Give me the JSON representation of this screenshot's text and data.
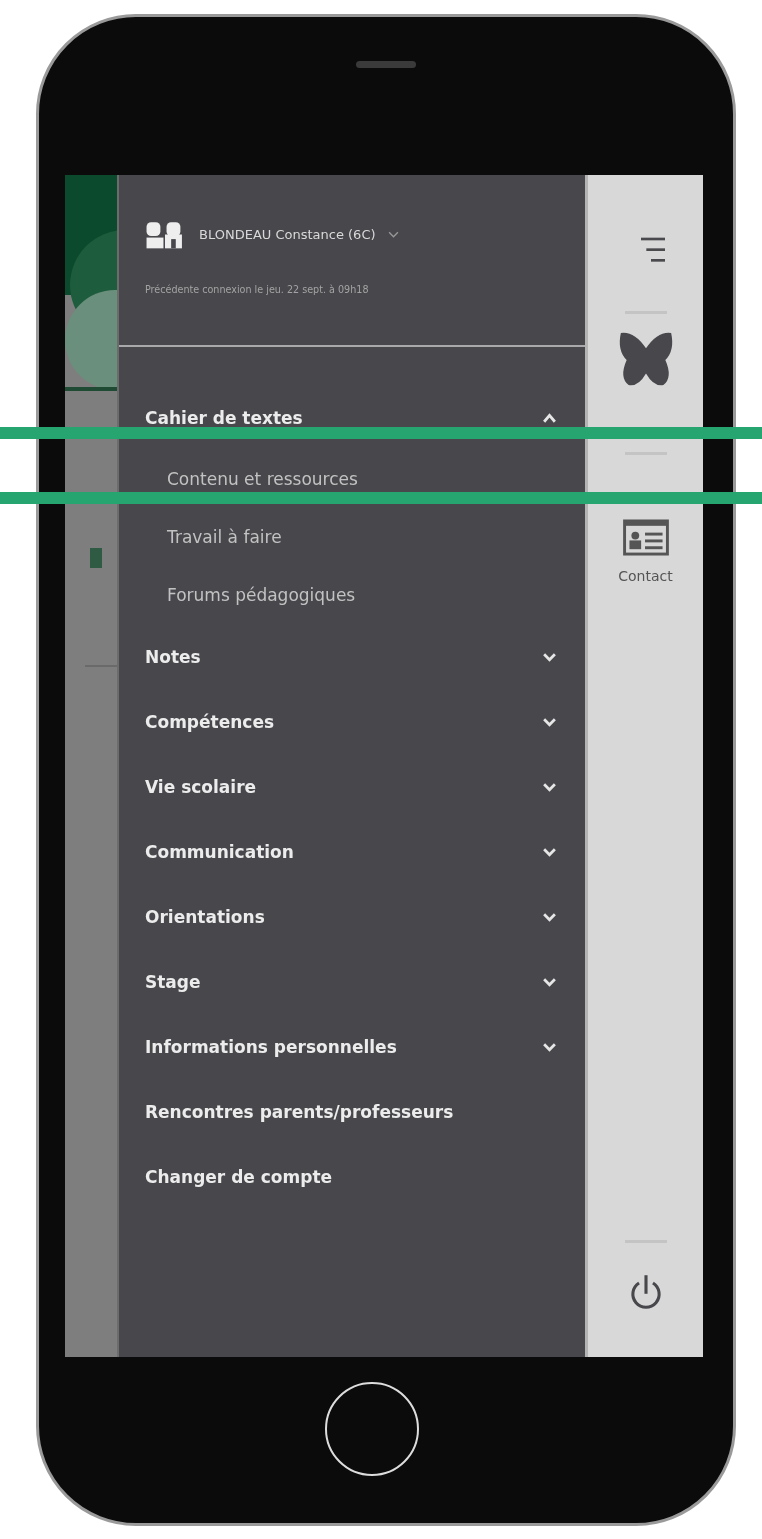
{
  "account": {
    "name": "BLONDEAU Constance (6C)",
    "last_login": "Précédente connexion le jeu. 22 sept. à 09h18"
  },
  "menu": [
    {
      "label": "Cahier de textes",
      "kind": "section",
      "expanded": true,
      "children": [
        {
          "label": "Contenu et ressources"
        },
        {
          "label": "Travail à faire"
        },
        {
          "label": "Forums pédagogiques"
        }
      ]
    },
    {
      "label": "Notes",
      "kind": "section",
      "expanded": false
    },
    {
      "label": "Compétences",
      "kind": "section",
      "expanded": false
    },
    {
      "label": "Vie scolaire",
      "kind": "section",
      "expanded": false
    },
    {
      "label": "Communication",
      "kind": "section",
      "expanded": false
    },
    {
      "label": "Orientations",
      "kind": "section",
      "expanded": false
    },
    {
      "label": "Stage",
      "kind": "section",
      "expanded": false
    },
    {
      "label": "Informations personnelles",
      "kind": "section",
      "expanded": false
    },
    {
      "label": "Rencontres parents/professeurs",
      "kind": "link"
    },
    {
      "label": "Changer de compte",
      "kind": "link"
    }
  ],
  "rail": {
    "contact_label": "Contact"
  }
}
